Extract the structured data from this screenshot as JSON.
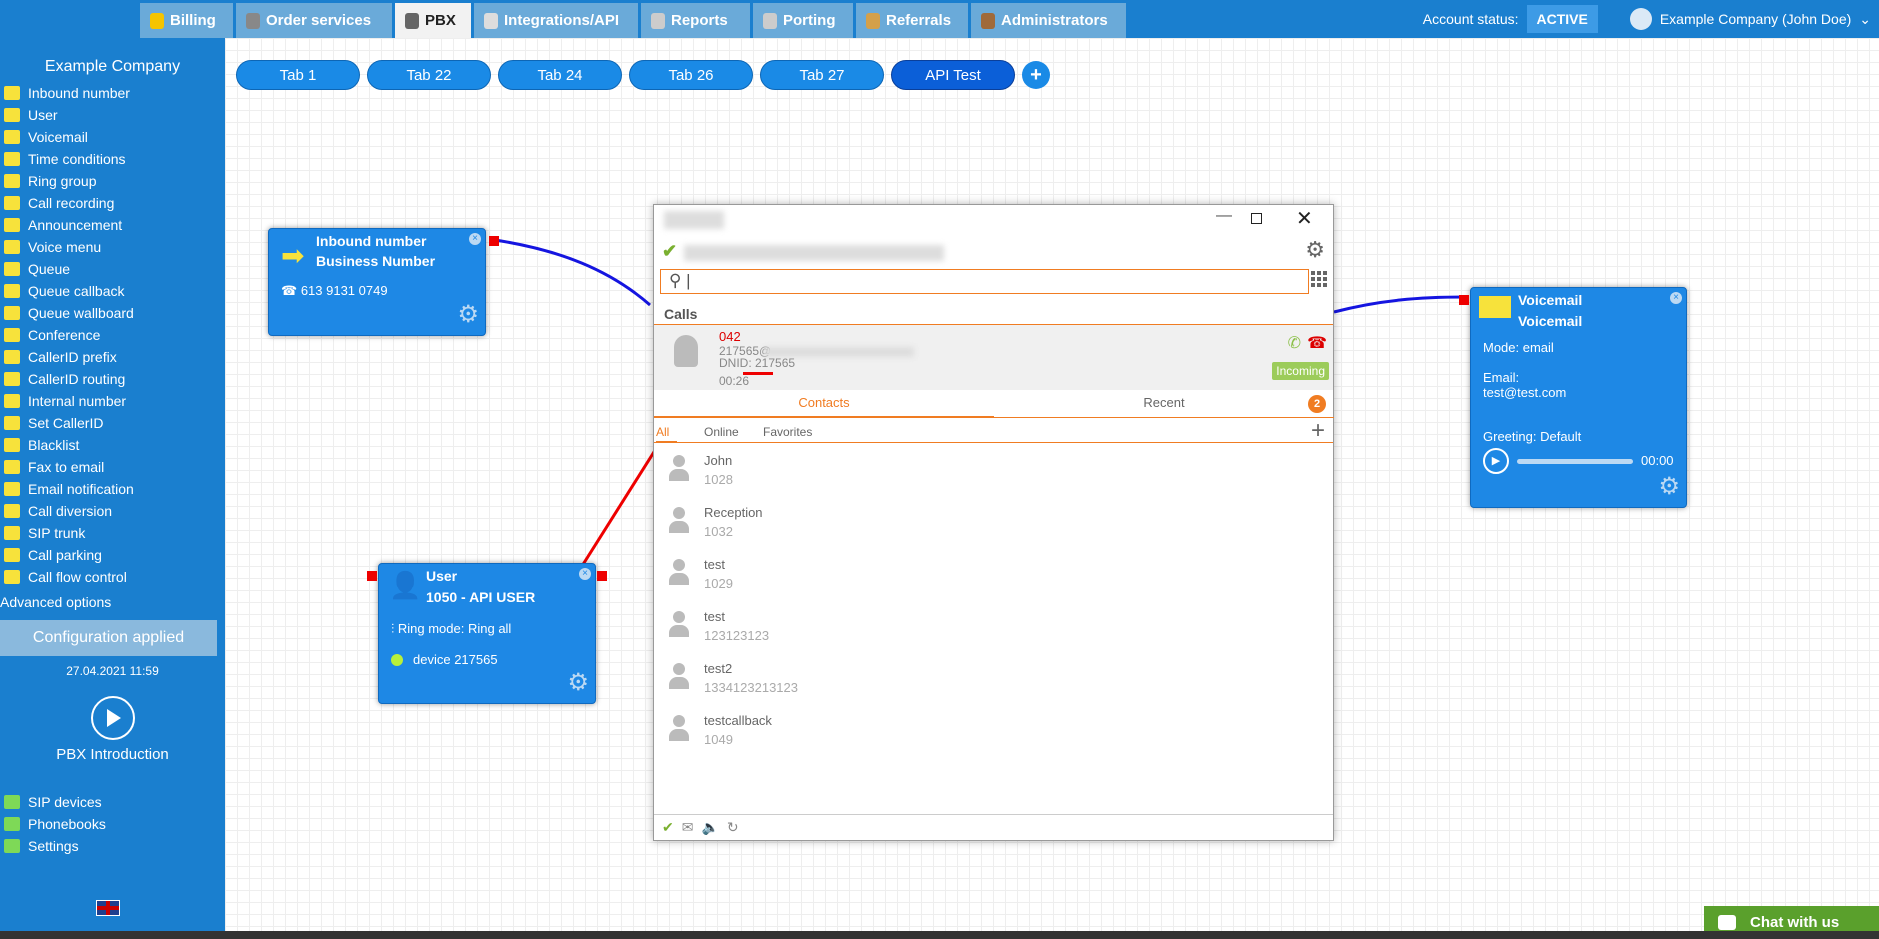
{
  "topnav": {
    "tabs": [
      {
        "label": "Billing",
        "icon": "coins-icon",
        "color": "#f5c400"
      },
      {
        "label": "Order services",
        "icon": "cart-icon",
        "color": "#888"
      },
      {
        "label": "PBX",
        "icon": "pbx-icon",
        "color": "#666"
      },
      {
        "label": "Integrations/API",
        "icon": "plug-icon",
        "color": "#ddd"
      },
      {
        "label": "Reports",
        "icon": "report-icon",
        "color": "#ccc"
      },
      {
        "label": "Porting",
        "icon": "phone-icon",
        "color": "#ccc"
      },
      {
        "label": "Referrals",
        "icon": "person-icon",
        "color": "#d4a04a"
      },
      {
        "label": "Administrators",
        "icon": "admin-icon",
        "color": "#a06a3a"
      }
    ],
    "active": "PBX",
    "account_status_label": "Account status:",
    "account_status": "ACTIVE",
    "user": "Example Company (John Doe)"
  },
  "sidebar": {
    "company": "Example Company",
    "items": [
      "Inbound number",
      "User",
      "Voicemail",
      "Time conditions",
      "Ring group",
      "Call recording",
      "Announcement",
      "Voice menu",
      "Queue",
      "Queue callback",
      "Queue wallboard",
      "Conference",
      "CallerID prefix",
      "CallerID routing",
      "Internal number",
      "Set CallerID",
      "Blacklist",
      "Fax to email",
      "Email notification",
      "Call diversion",
      "SIP trunk",
      "Call parking",
      "Call flow control"
    ],
    "advanced": "Advanced options",
    "config_status": "Configuration applied",
    "config_date": "27.04.2021 11:59",
    "intro": "PBX Introduction",
    "bottom_items": [
      "SIP devices",
      "Phonebooks",
      "Settings"
    ]
  },
  "canvas_tabs": [
    "Tab 1",
    "Tab 22",
    "Tab 24",
    "Tab 26",
    "Tab 27",
    "API Test"
  ],
  "selected_tab": "API Test",
  "inbound_node": {
    "title": "Inbound number",
    "subtitle": "Business Number",
    "phone": "613 9131 0749"
  },
  "user_node": {
    "title": "User",
    "subtitle": "1050 - API USER",
    "ring_mode": "Ring mode: Ring all",
    "device_label": "device",
    "device_id": "217565"
  },
  "voicemail_node": {
    "title": "Voicemail",
    "subtitle": "Voicemail",
    "mode": "Mode: email",
    "email_label": "Email:",
    "email": "test@test.com",
    "greeting": "Greeting: Default",
    "time": "00:00"
  },
  "softphone": {
    "calls_label": "Calls",
    "call": {
      "number": "042",
      "from": "217565@",
      "dnid": "DNID: 217565",
      "duration": "00:26",
      "status": "Incoming"
    },
    "tabs": [
      "Contacts",
      "Recent"
    ],
    "recent_badge": "2",
    "filters": [
      "All",
      "Online",
      "Favorites"
    ],
    "contacts": [
      {
        "name": "John",
        "number": "1028"
      },
      {
        "name": "Reception",
        "number": "1032"
      },
      {
        "name": "test",
        "number": "1029"
      },
      {
        "name": "test",
        "number": "123123123"
      },
      {
        "name": "test2",
        "number": "1334123213123"
      },
      {
        "name": "testcallback",
        "number": "1049"
      }
    ]
  },
  "chat": {
    "label": "Chat with us"
  },
  "colors": {
    "brand": "#1a7fcf",
    "orange": "#f07c22",
    "incoming": "#9ccc5a",
    "annotation": "#e00000"
  }
}
